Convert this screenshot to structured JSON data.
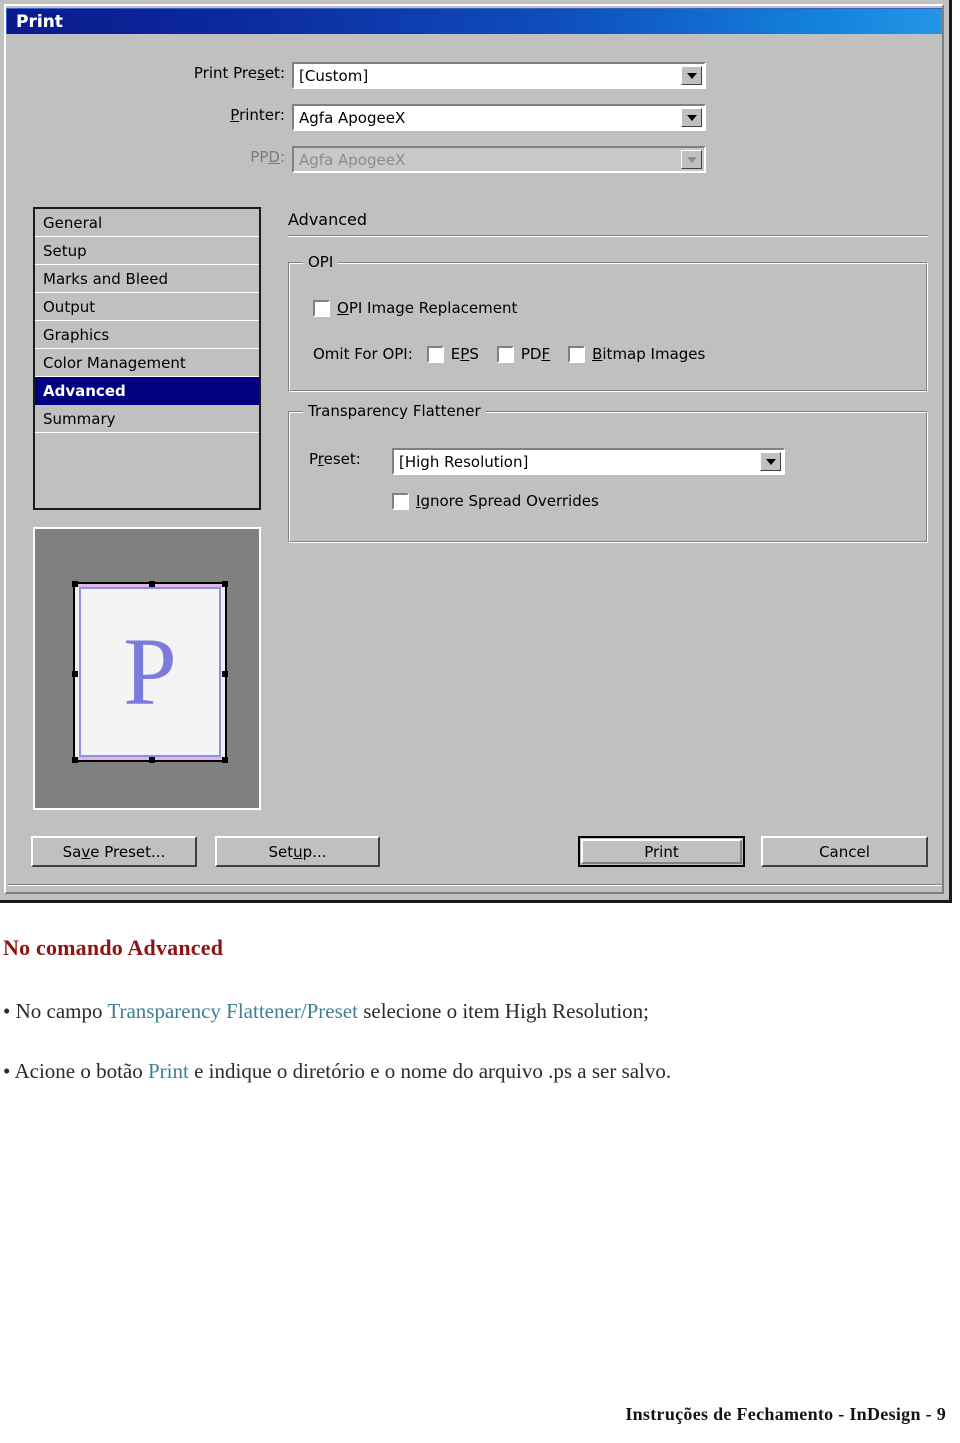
{
  "dialog": {
    "title": "Print",
    "fields": [
      {
        "label_pre": "Print Pre",
        "label_acc": "s",
        "label_post": "et:",
        "value": "[Custom]",
        "disabled": false
      },
      {
        "label_pre": "",
        "label_acc": "P",
        "label_post": "rinter:",
        "value": "Agfa ApogeeX",
        "disabled": false
      },
      {
        "label_pre": "PP",
        "label_acc": "D",
        "label_post": ":",
        "value": "Agfa ApogeeX",
        "disabled": true
      }
    ],
    "sidebar": {
      "items": [
        {
          "label": "General",
          "selected": false
        },
        {
          "label": "Setup",
          "selected": false
        },
        {
          "label": "Marks and Bleed",
          "selected": false
        },
        {
          "label": "Output",
          "selected": false
        },
        {
          "label": "Graphics",
          "selected": false
        },
        {
          "label": "Color Management",
          "selected": false
        },
        {
          "label": "Advanced",
          "selected": true
        },
        {
          "label": "Summary",
          "selected": false
        }
      ]
    },
    "preview": {
      "page_letter": "P"
    },
    "pane": {
      "title": "Advanced",
      "opi": {
        "group_label": "OPI",
        "image_replacement": {
          "pre": "",
          "acc": "O",
          "post": "PI Image Replacement",
          "checked": false
        },
        "omit_label": "Omit For OPI:",
        "omit_options": [
          {
            "pre": "E",
            "acc": "P",
            "post": "S",
            "checked": false
          },
          {
            "pre": "PD",
            "acc": "F",
            "post": "",
            "checked": false
          },
          {
            "pre": "",
            "acc": "B",
            "post": "itmap Images",
            "checked": false
          }
        ]
      },
      "flattener": {
        "group_label": "Transparency Flattener",
        "preset_label_pre": "P",
        "preset_label_acc": "r",
        "preset_label_post": "eset:",
        "preset_value": "[High Resolution]",
        "ignore_spread": {
          "pre": "",
          "acc": "I",
          "post": "gnore Spread Overrides",
          "checked": false
        }
      }
    },
    "buttons": {
      "save_preset_pre": "Sa",
      "save_preset_acc": "v",
      "save_preset_post": "e Preset...",
      "setup_pre": "Set",
      "setup_acc": "u",
      "setup_post": "p...",
      "print": "Print",
      "cancel": "Cancel"
    },
    "colors": {
      "face": "#c0c0c0",
      "title_gradient_start": "#0a1a8c",
      "title_gradient_end": "#2596e6",
      "selection": "#000080",
      "preview_bg": "#808080",
      "page_letter": "#7b7bdc"
    }
  },
  "document": {
    "heading": "No comando Advanced",
    "bullets": [
      {
        "bullet": "•",
        "parts": [
          {
            "text": "No campo ",
            "highlight": false
          },
          {
            "text": "Transparency Flattener/Preset",
            "highlight": true
          },
          {
            "text": " selecione o item High Resolution;",
            "highlight": false
          }
        ]
      },
      {
        "bullet": "•",
        "parts": [
          {
            "text": "Acione o botão ",
            "highlight": false
          },
          {
            "text": "Print",
            "highlight": true
          },
          {
            "text": " e indique o diretório e o nome do arquivo .ps a ser salvo.",
            "highlight": false
          }
        ]
      }
    ],
    "footer": "Instruções de Fechamento - InDesign - 9",
    "colors": {
      "heading": "#8e1414",
      "highlight": "#3f7f95",
      "body": "#2a2a2a"
    }
  }
}
